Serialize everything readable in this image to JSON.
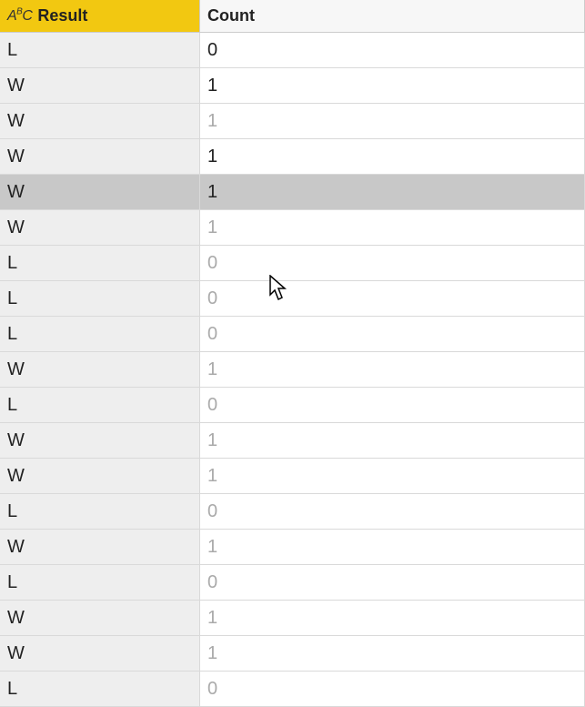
{
  "columns": {
    "result": "Result",
    "count": "Count",
    "typeIcon": "ABC"
  },
  "rows": [
    {
      "result": "L",
      "count": "0",
      "strong": true,
      "selected": false
    },
    {
      "result": "W",
      "count": "1",
      "strong": true,
      "selected": false
    },
    {
      "result": "W",
      "count": "1",
      "strong": false,
      "selected": false
    },
    {
      "result": "W",
      "count": "1",
      "strong": true,
      "selected": false
    },
    {
      "result": "W",
      "count": "1",
      "strong": true,
      "selected": true
    },
    {
      "result": "W",
      "count": "1",
      "strong": false,
      "selected": false
    },
    {
      "result": "L",
      "count": "0",
      "strong": false,
      "selected": false
    },
    {
      "result": "L",
      "count": "0",
      "strong": false,
      "selected": false
    },
    {
      "result": "L",
      "count": "0",
      "strong": false,
      "selected": false
    },
    {
      "result": "W",
      "count": "1",
      "strong": false,
      "selected": false
    },
    {
      "result": "L",
      "count": "0",
      "strong": false,
      "selected": false
    },
    {
      "result": "W",
      "count": "1",
      "strong": false,
      "selected": false
    },
    {
      "result": "W",
      "count": "1",
      "strong": false,
      "selected": false
    },
    {
      "result": "L",
      "count": "0",
      "strong": false,
      "selected": false
    },
    {
      "result": "W",
      "count": "1",
      "strong": false,
      "selected": false
    },
    {
      "result": "L",
      "count": "0",
      "strong": false,
      "selected": false
    },
    {
      "result": "W",
      "count": "1",
      "strong": false,
      "selected": false
    },
    {
      "result": "W",
      "count": "1",
      "strong": false,
      "selected": false
    },
    {
      "result": "L",
      "count": "0",
      "strong": false,
      "selected": false
    }
  ]
}
